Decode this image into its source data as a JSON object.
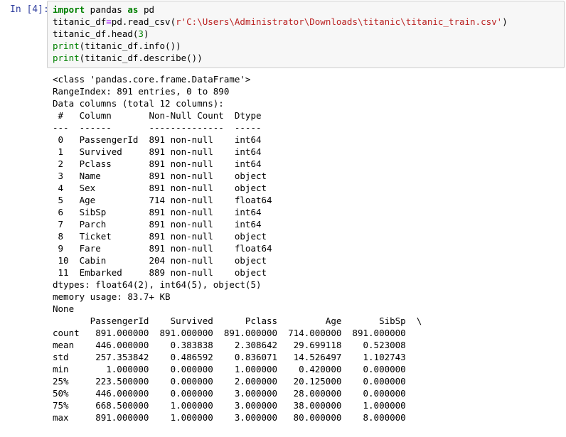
{
  "cell": {
    "prompt": "In [4]:",
    "code": {
      "line1_kw1": "import",
      "line1_mod": " pandas ",
      "line1_kw2": "as",
      "line1_alias": " pd",
      "line2_var": "titanic_df",
      "line2_eq": "=",
      "line2_call": "pd.read_csv(",
      "line2_str": "r'C:\\Users\\Administrator\\Downloads\\titanic\\titanic_train.csv'",
      "line2_close": ")",
      "line3_pre": "titanic_df.head(",
      "line3_num": "3",
      "line3_post": ")",
      "line4_fn": "print",
      "line4_rest": "(titanic_df.info())",
      "line5_fn": "print",
      "line5_rest": "(titanic_df.describe())"
    }
  },
  "output_lines": [
    "<class 'pandas.core.frame.DataFrame'>",
    "RangeIndex: 891 entries, 0 to 890",
    "Data columns (total 12 columns):",
    " #   Column       Non-Null Count  Dtype  ",
    "---  ------       --------------  -----  ",
    " 0   PassengerId  891 non-null    int64  ",
    " 1   Survived     891 non-null    int64  ",
    " 2   Pclass       891 non-null    int64  ",
    " 3   Name         891 non-null    object ",
    " 4   Sex          891 non-null    object ",
    " 5   Age          714 non-null    float64",
    " 6   SibSp        891 non-null    int64  ",
    " 7   Parch        891 non-null    int64  ",
    " 8   Ticket       891 non-null    object ",
    " 9   Fare         891 non-null    float64",
    " 10  Cabin        204 non-null    object ",
    " 11  Embarked     889 non-null    object ",
    "dtypes: float64(2), int64(5), object(5)",
    "memory usage: 83.7+ KB",
    "None",
    "       PassengerId    Survived      Pclass         Age       SibSp  \\",
    "count   891.000000  891.000000  891.000000  714.000000  891.000000   ",
    "mean    446.000000    0.383838    2.308642   29.699118    0.523008   ",
    "std     257.353842    0.486592    0.836071   14.526497    1.102743   ",
    "min       1.000000    0.000000    1.000000    0.420000    0.000000   ",
    "25%     223.500000    0.000000    2.000000   20.125000    0.000000   ",
    "50%     446.000000    0.000000    3.000000   28.000000    0.000000   ",
    "75%     668.500000    1.000000    3.000000   38.000000    1.000000   ",
    "max     891.000000    1.000000    3.000000   80.000000    8.000000   "
  ]
}
